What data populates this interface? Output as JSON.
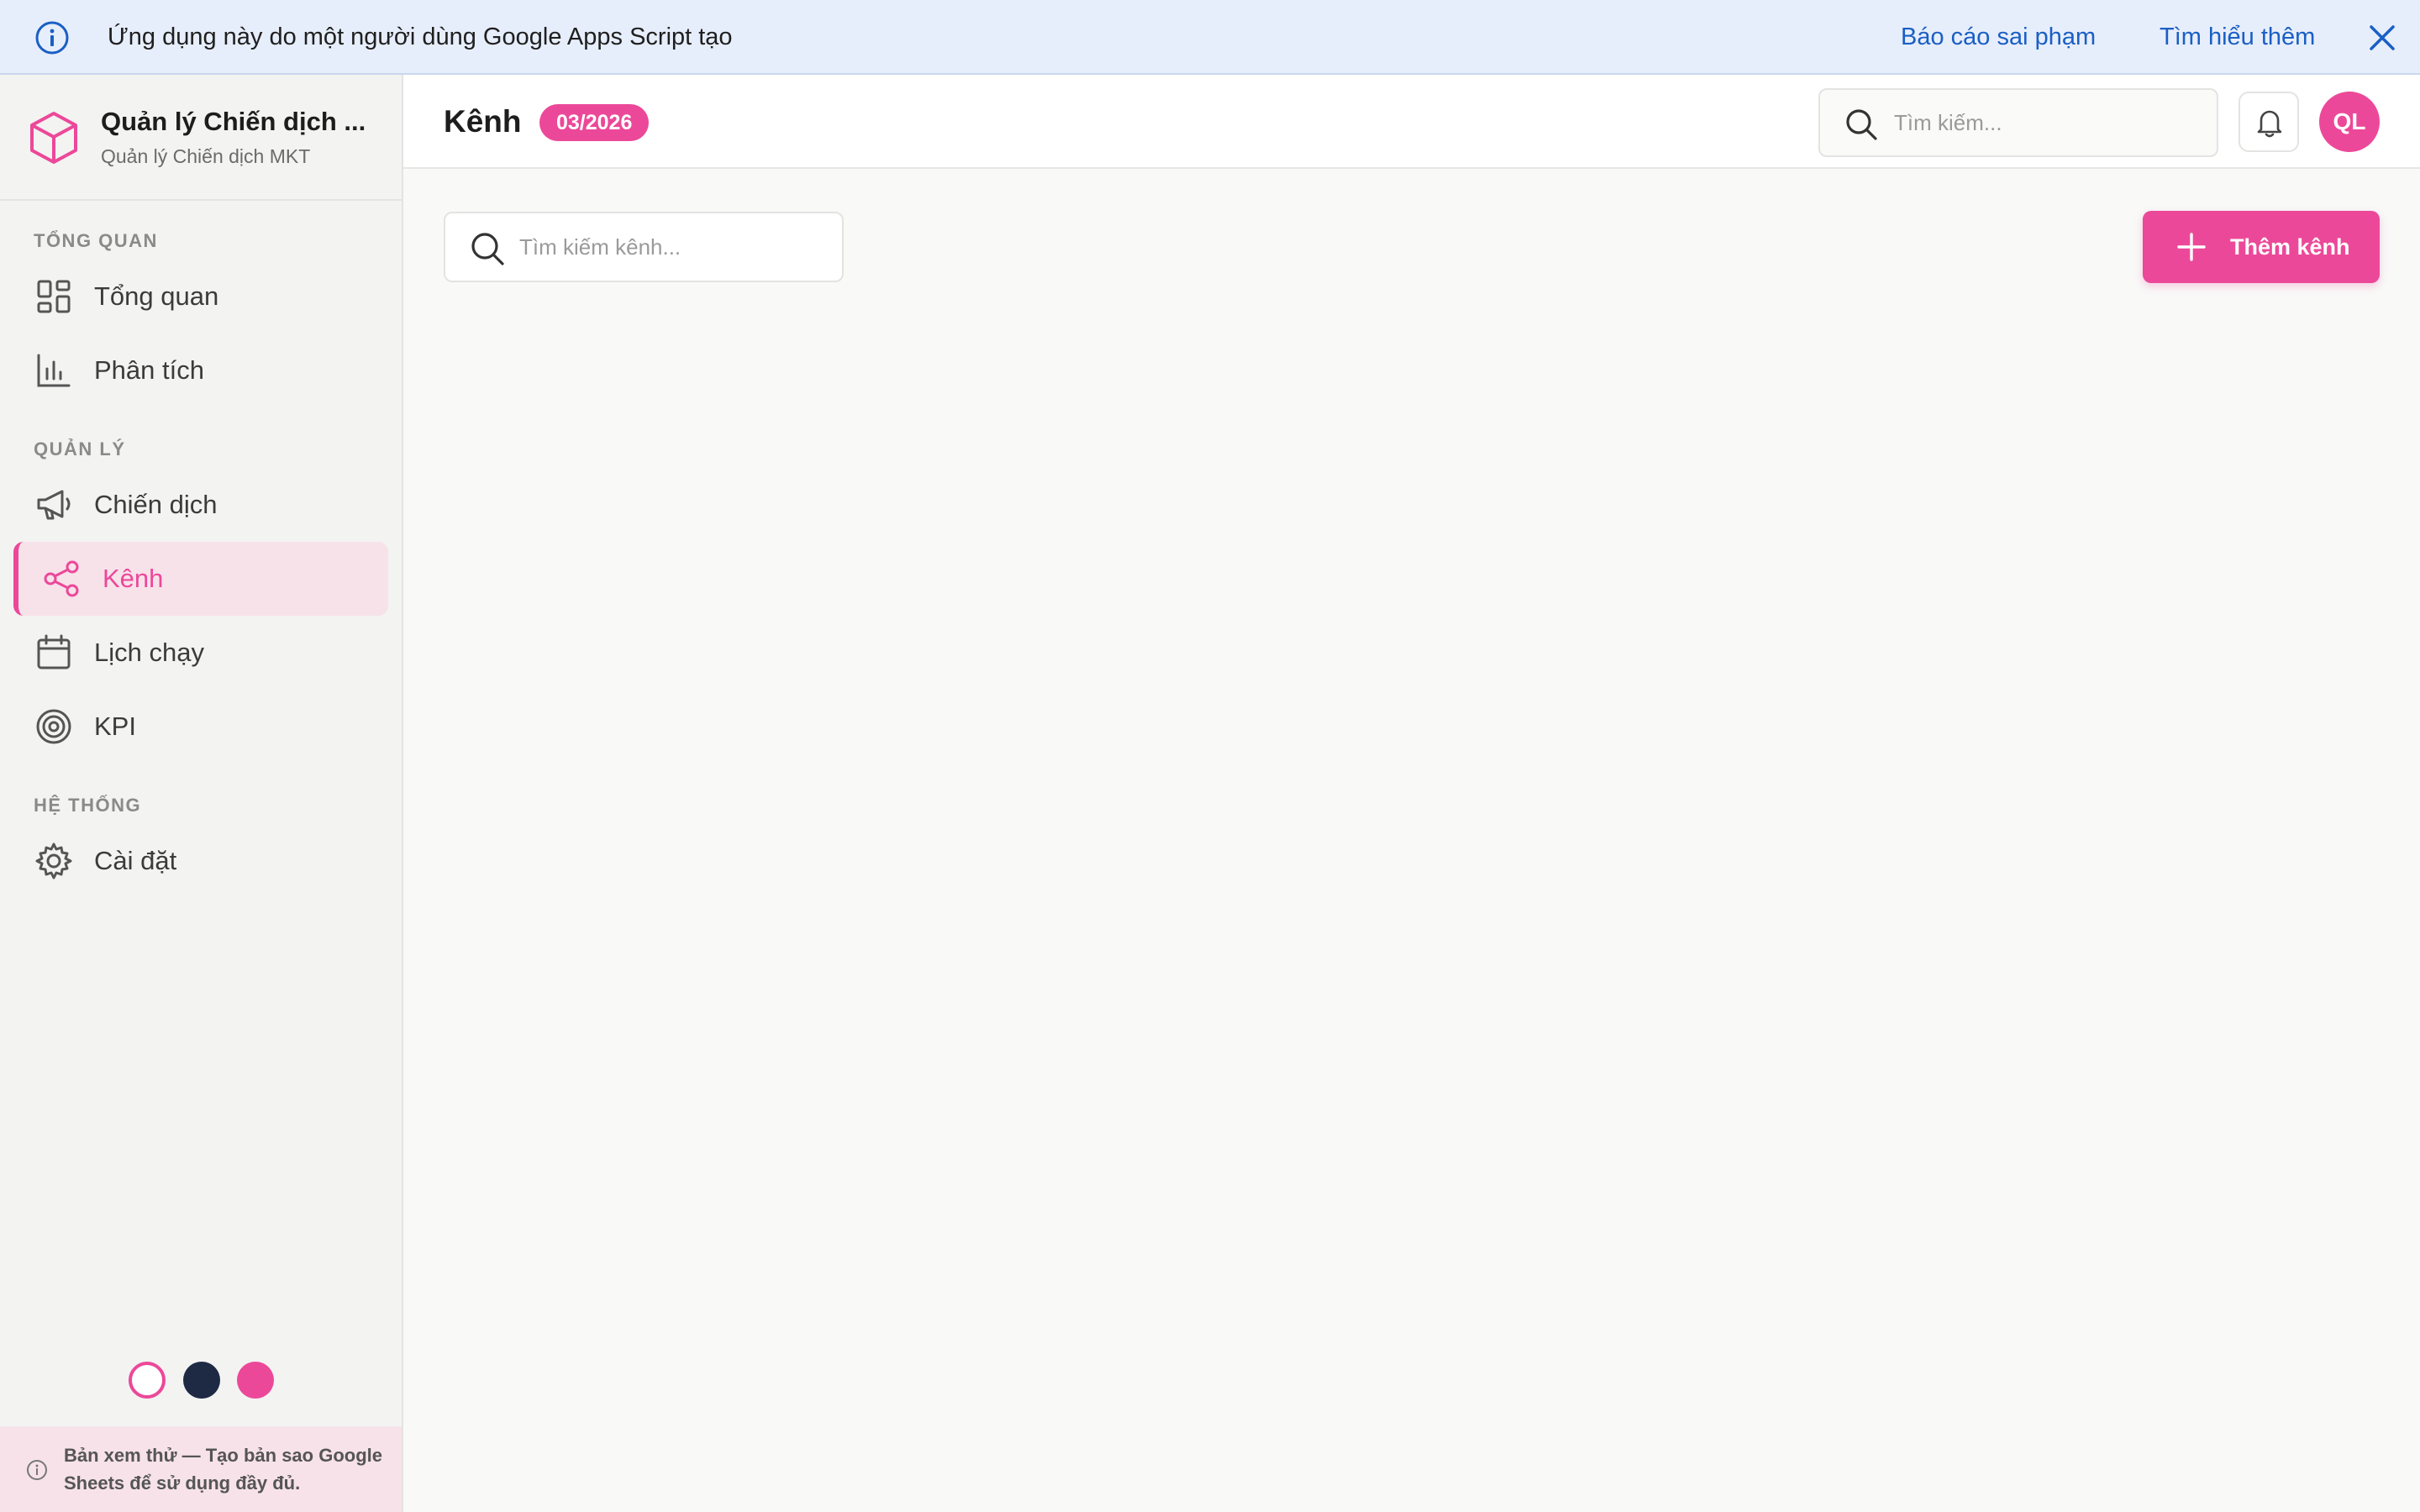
{
  "banner": {
    "message": "Ứng dụng này do một người dùng Google Apps Script tạo",
    "report_link": "Báo cáo sai phạm",
    "learn_more_link": "Tìm hiểu thêm",
    "info_icon": "info-circle-icon",
    "close_icon": "close-icon"
  },
  "sidebar": {
    "app_name": "Quản lý Chiến dịch ...",
    "app_subtitle": "Quản lý Chiến dịch MKT",
    "logo_icon": "cube-icon",
    "sections": [
      {
        "title": "TỔNG QUAN",
        "items": [
          {
            "label": "Tổng quan",
            "icon": "dashboard-grid-icon"
          },
          {
            "label": "Phân tích",
            "icon": "bar-chart-icon"
          }
        ]
      },
      {
        "title": "QUẢN LÝ",
        "items": [
          {
            "label": "Chiến dịch",
            "icon": "megaphone-icon"
          },
          {
            "label": "Kênh",
            "icon": "share-icon",
            "active": true
          },
          {
            "label": "Lịch chạy",
            "icon": "calendar-icon"
          },
          {
            "label": "KPI",
            "icon": "target-icon"
          }
        ]
      },
      {
        "title": "HỆ THỐNG",
        "items": [
          {
            "label": "Cài đặt",
            "icon": "gear-icon"
          }
        ]
      }
    ],
    "theme_swatches": [
      "#ffffff",
      "#1e2a44",
      "#ec4899"
    ],
    "preview_note": "Bản xem thử — Tạo bản sao Google Sheets để sử dụng đầy đủ."
  },
  "header": {
    "title": "Kênh",
    "period_badge": "03/2026",
    "search_placeholder": "Tìm kiếm...",
    "avatar_initials": "QL"
  },
  "main": {
    "channel_search_placeholder": "Tìm kiếm kênh...",
    "add_button_label": "Thêm kênh"
  },
  "colors": {
    "accent": "#ec4899",
    "banner_link": "#1a5fc4",
    "active_bg": "#f7e2ea"
  }
}
